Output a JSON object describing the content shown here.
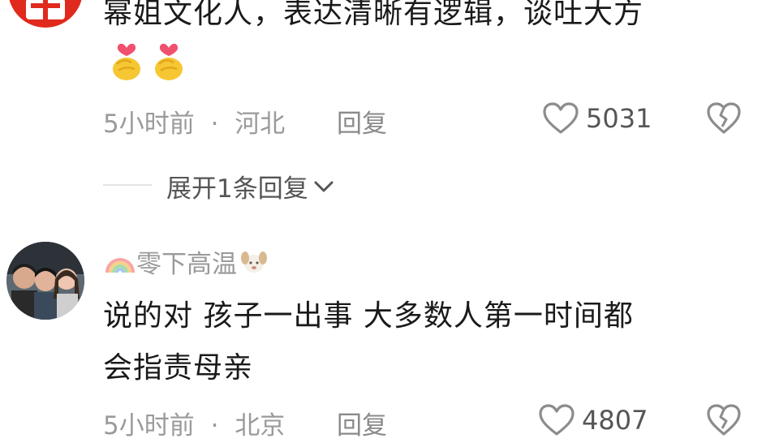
{
  "comments": [
    {
      "text_line1": "幂姐文化人，表达清晰有逻辑，谈吐大方",
      "emojis": [
        "heart-hands-emoji",
        "heart-hands-emoji"
      ],
      "time": "5小时前",
      "separator": "·",
      "location": "河北",
      "reply_label": "回复",
      "like_count": "5031",
      "expand_label": "展开1条回复"
    },
    {
      "username": "零下高温",
      "text_line1": "说的对  孩子一出事  大多数人第一时间都",
      "text_line2": "会指责母亲",
      "time": "5小时前",
      "separator": "·",
      "location": "北京",
      "reply_label": "回复",
      "like_count": "4807"
    }
  ],
  "icons": {
    "like": "heart-outline-icon",
    "dislike": "broken-heart-icon",
    "expand": "chevron-down-icon",
    "username_prefix": "rainbow-icon",
    "username_suffix": "dog-icon"
  },
  "colors": {
    "text": "#1a1a1a",
    "meta": "#9a9a9a",
    "avatar_top": "#e02a1d"
  }
}
